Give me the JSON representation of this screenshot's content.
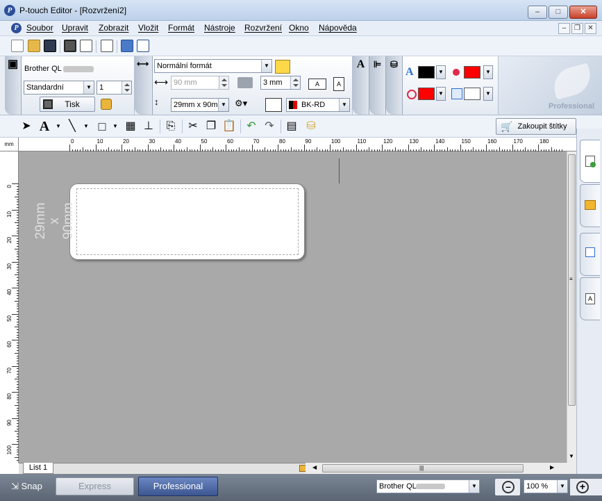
{
  "window": {
    "title": "P-touch Editor - [Rozvržení2]",
    "minimize": "–",
    "maximize": "□",
    "close": "✕",
    "mdi_min": "–",
    "mdi_restore": "❐",
    "mdi_close": "✕"
  },
  "menu": [
    "Soubor",
    "Upravit",
    "Zobrazit",
    "Vložit",
    "Formát",
    "Nástroje",
    "Rozvržení",
    "Okno",
    "Nápověda"
  ],
  "printer": {
    "name": "Brother QL",
    "mode": "Standardní",
    "copies": "1",
    "print_label": "Tisk"
  },
  "layout": {
    "format": "Normální formát",
    "length": "90 mm",
    "margin": "3 mm",
    "tape_size": "29mm x 90m",
    "tape_color": "BK-RD"
  },
  "brand_text": "Professional",
  "toolbar2": {
    "buy_labels": "Zakoupit štítky"
  },
  "canvas": {
    "size_text": "29mm x 90mm",
    "ruler_unit": "mm",
    "h_ticks": [
      "0",
      "10",
      "20",
      "30",
      "40",
      "50",
      "60",
      "70",
      "80",
      "90",
      "100",
      "110",
      "120",
      "130",
      "140",
      "150",
      "160",
      "170",
      "180"
    ],
    "v_ticks": [
      "0",
      "10",
      "20",
      "30",
      "40",
      "50",
      "60",
      "70",
      "80",
      "90",
      "100"
    ]
  },
  "sheet_tab": "List 1",
  "status": {
    "snap": "Snap",
    "express": "Express",
    "professional": "Professional",
    "printer": "Brother QL",
    "zoom": "100 %"
  },
  "colors": {
    "text_color": "#000000",
    "fill_color": "#ff0000",
    "line_color": "#ff0000",
    "shadow_color": "#ffffff"
  }
}
